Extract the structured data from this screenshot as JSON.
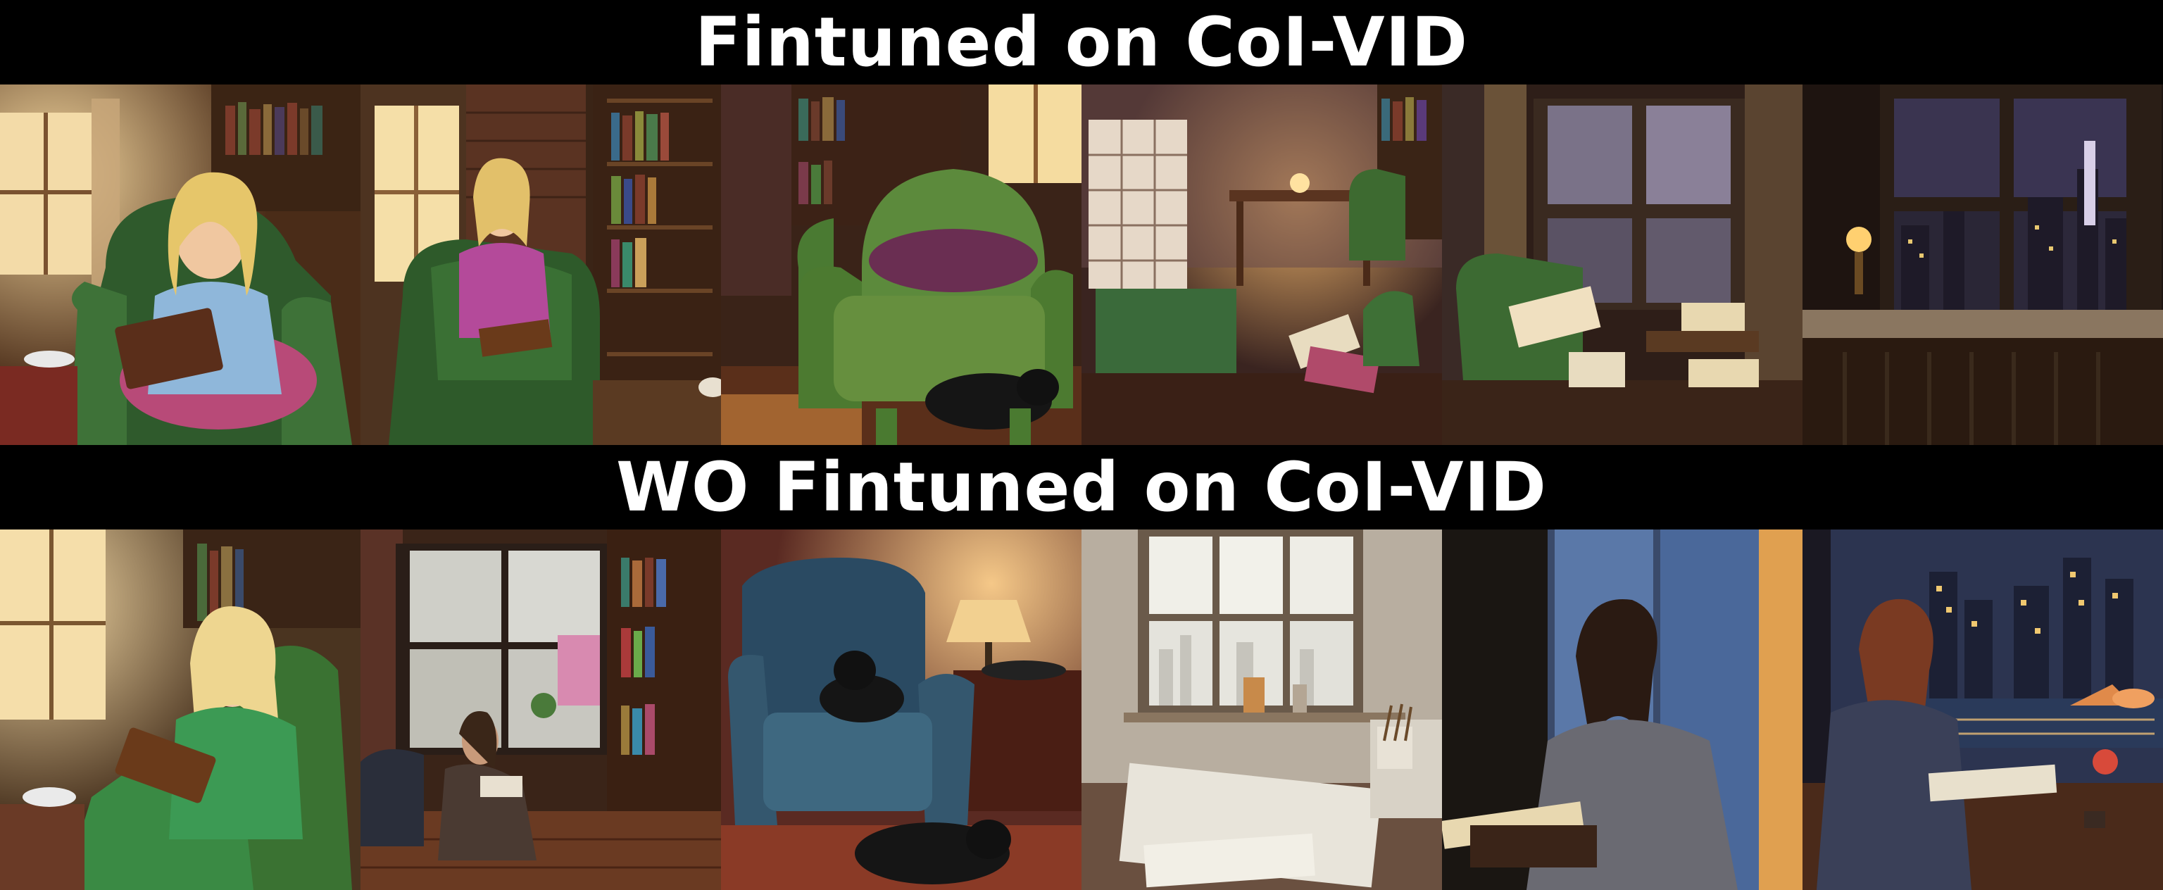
{
  "rows": [
    {
      "title": "Fintuned on CoI-VID",
      "frames": [
        {
          "scene": "woman-reading-in-green-armchair"
        },
        {
          "scene": "woman-reading-by-window"
        },
        {
          "scene": "empty-armchair-with-cat"
        },
        {
          "scene": "room-with-desk-and-lamp"
        },
        {
          "scene": "room-with-windows-rain"
        },
        {
          "scene": "night-window-city"
        }
      ]
    },
    {
      "title": "WO Fintuned on CoI-VID",
      "frames": [
        {
          "scene": "woman-reading-in-green-armchair"
        },
        {
          "scene": "woman-reading-on-floor-by-window"
        },
        {
          "scene": "blue-armchair-with-cats-and-lamp"
        },
        {
          "scene": "desk-with-pencils-by-window"
        },
        {
          "scene": "woman-reading-by-rainy-window"
        },
        {
          "scene": "woman-reading-at-night-city-window"
        }
      ]
    }
  ]
}
